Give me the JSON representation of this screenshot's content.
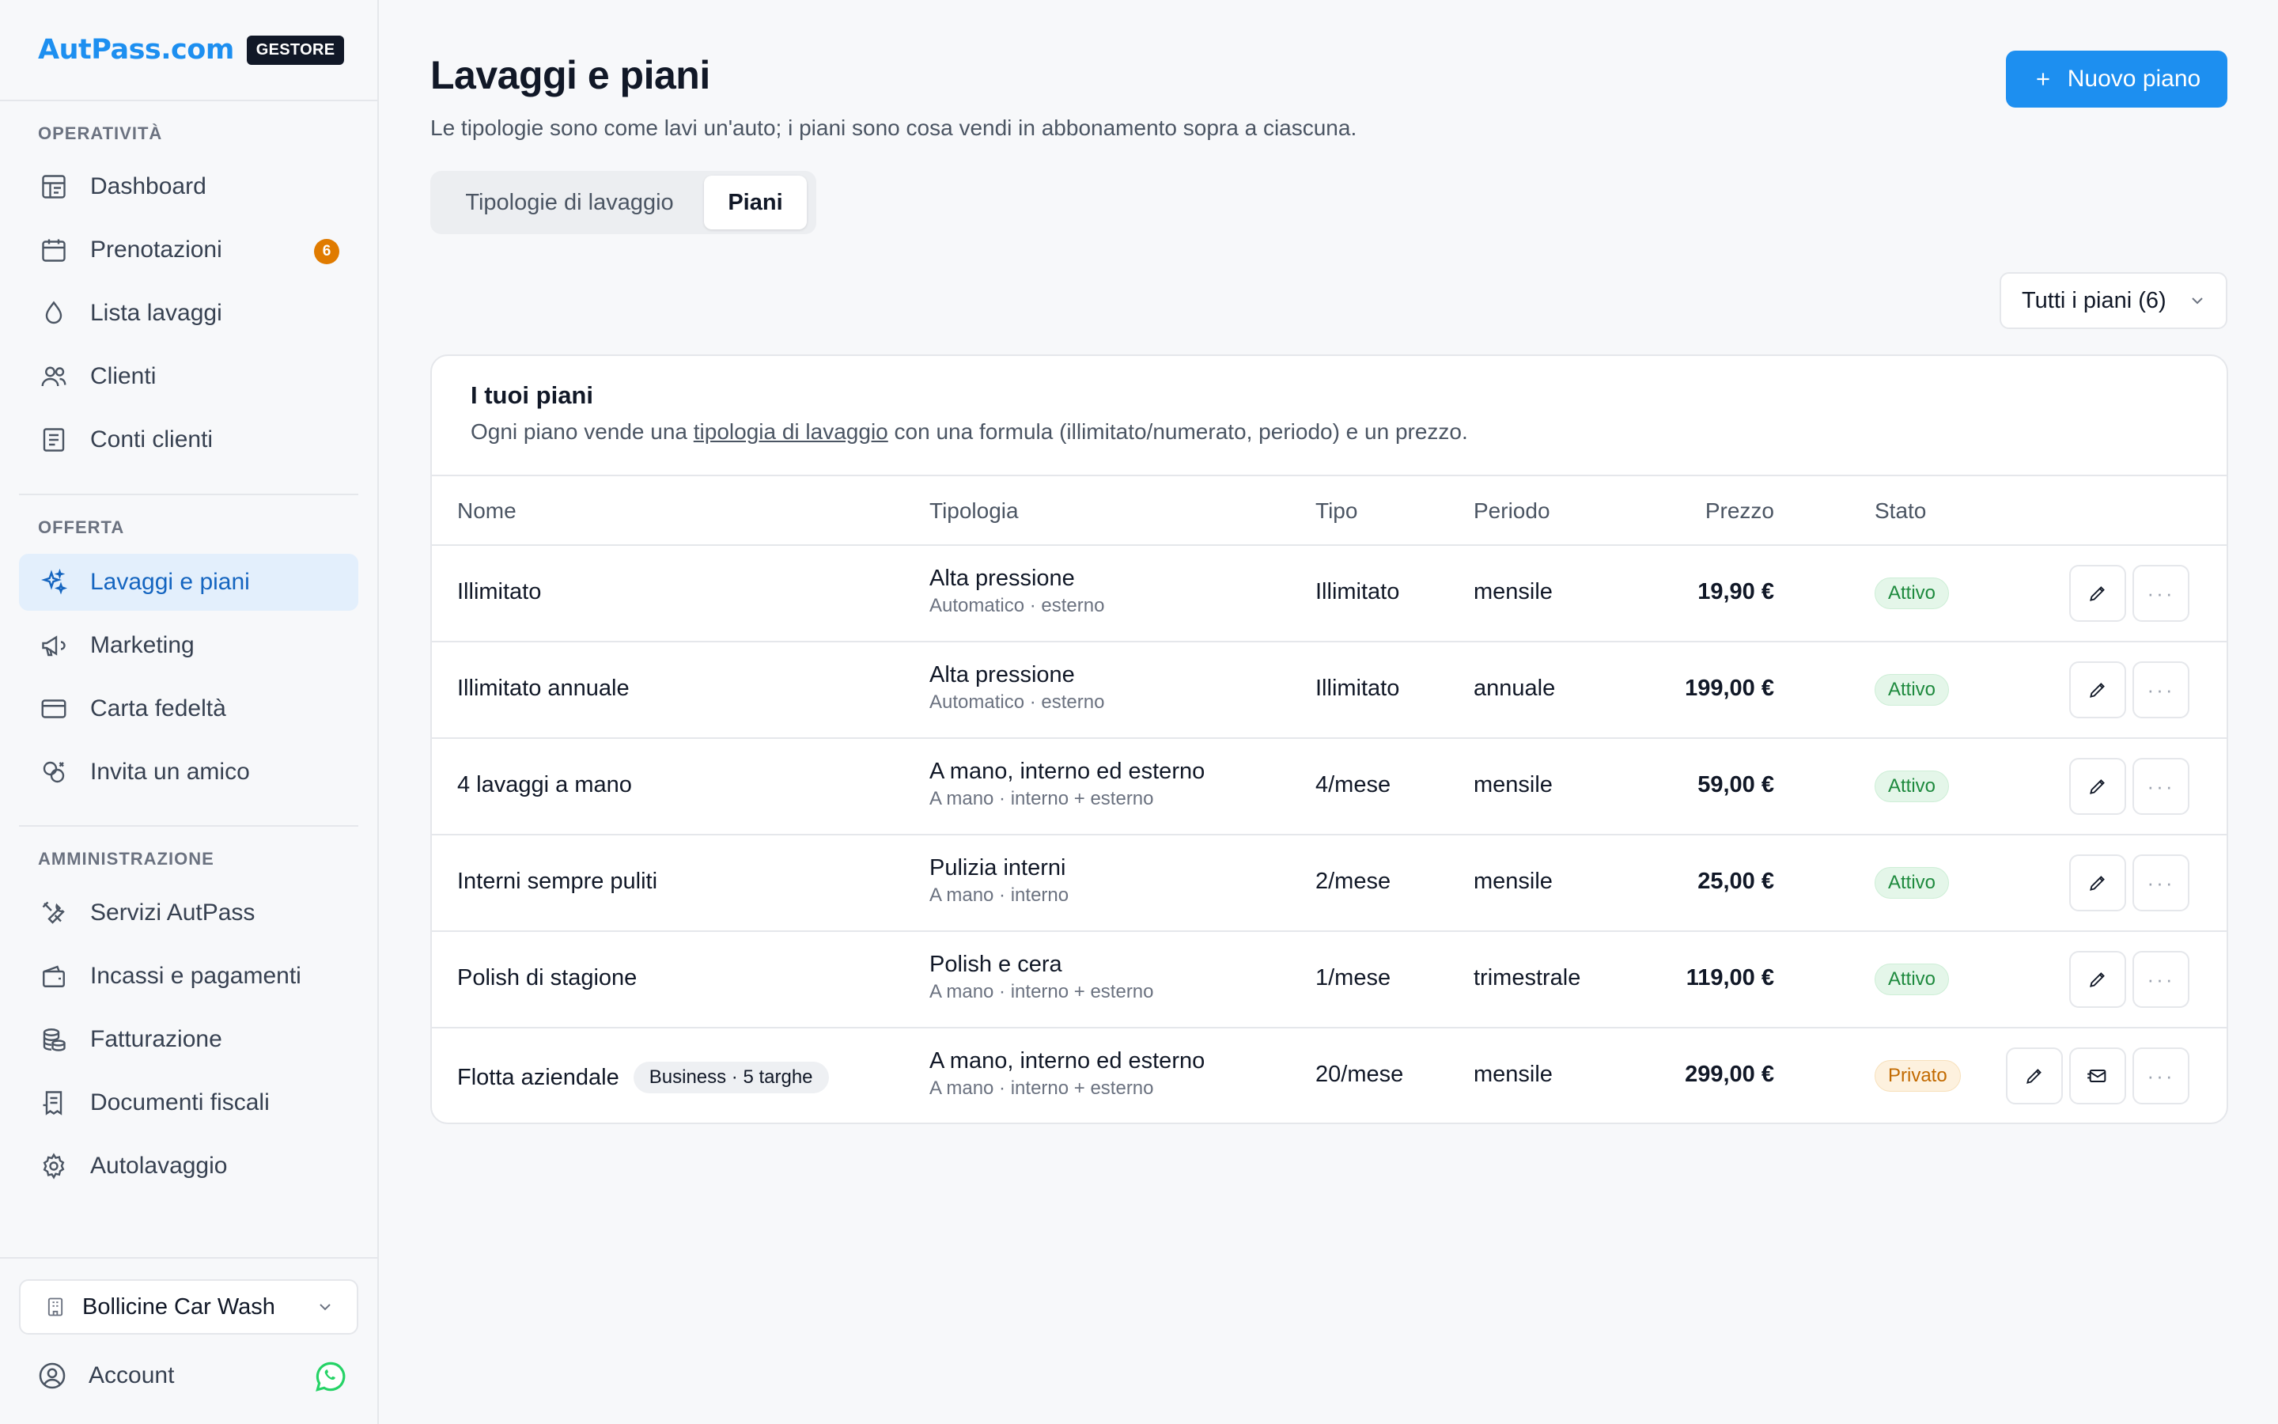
{
  "brand": {
    "logo": "AutPass.com",
    "badge": "GESTORE"
  },
  "sidebar": {
    "sections": [
      {
        "title": "OPERATIVITÀ"
      },
      {
        "title": "OFFERTA"
      },
      {
        "title": "AMMINISTRAZIONE"
      }
    ],
    "items": [
      {
        "label": "Dashboard",
        "icon": "dashboard-icon"
      },
      {
        "label": "Prenotazioni",
        "icon": "calendar-icon",
        "badge": "6"
      },
      {
        "label": "Lista lavaggi",
        "icon": "drop-icon"
      },
      {
        "label": "Clienti",
        "icon": "users-icon"
      },
      {
        "label": "Conti clienti",
        "icon": "ledger-icon"
      },
      {
        "label": "Lavaggi e piani",
        "icon": "sparkle-icon",
        "active": true
      },
      {
        "label": "Marketing",
        "icon": "megaphone-icon"
      },
      {
        "label": "Carta fedeltà",
        "icon": "card-icon"
      },
      {
        "label": "Invita un amico",
        "icon": "invite-icon"
      },
      {
        "label": "Servizi AutPass",
        "icon": "tools-icon"
      },
      {
        "label": "Incassi e pagamenti",
        "icon": "wallet-icon"
      },
      {
        "label": "Fatturazione",
        "icon": "coins-icon"
      },
      {
        "label": "Documenti fiscali",
        "icon": "receipt-icon"
      },
      {
        "label": "Autolavaggio",
        "icon": "gear-icon"
      }
    ],
    "store": {
      "name": "Bollicine Car Wash"
    },
    "account": {
      "label": "Account"
    }
  },
  "header": {
    "title": "Lavaggi e piani",
    "subtitle": "Le tipologie sono come lavi un'auto; i piani sono cosa vendi in abbonamento sopra a ciascuna.",
    "new_button": "Nuovo piano"
  },
  "tabs": [
    {
      "label": "Tipologie di lavaggio",
      "active": false
    },
    {
      "label": "Piani",
      "active": true
    }
  ],
  "filter": {
    "selected": "Tutti i piani (6)"
  },
  "card": {
    "title": "I tuoi piani",
    "subtitle_before": "Ogni piano vende una ",
    "subtitle_link": "tipologia di lavaggio",
    "subtitle_after": " con una formula (illimitato/numerato, periodo) e un prezzo."
  },
  "table": {
    "columns": [
      "Nome",
      "Tipologia",
      "Tipo",
      "Periodo",
      "Prezzo",
      "Stato"
    ],
    "rows": [
      {
        "name": "Illimitato",
        "badge": "",
        "tip_main": "Alta pressione",
        "tip_sub": "Automatico · esterno",
        "tipo": "Illimitato",
        "periodo": "mensile",
        "prezzo": "19,90 €",
        "stato": "Attivo",
        "stato_kind": "ok",
        "extra_action": false
      },
      {
        "name": "Illimitato annuale",
        "badge": "",
        "tip_main": "Alta pressione",
        "tip_sub": "Automatico · esterno",
        "tipo": "Illimitato",
        "periodo": "annuale",
        "prezzo": "199,00 €",
        "stato": "Attivo",
        "stato_kind": "ok",
        "extra_action": false
      },
      {
        "name": "4 lavaggi a mano",
        "badge": "",
        "tip_main": "A mano, interno ed esterno",
        "tip_sub": "A mano · interno + esterno",
        "tipo": "4/mese",
        "periodo": "mensile",
        "prezzo": "59,00 €",
        "stato": "Attivo",
        "stato_kind": "ok",
        "extra_action": false
      },
      {
        "name": "Interni sempre puliti",
        "badge": "",
        "tip_main": "Pulizia interni",
        "tip_sub": "A mano · interno",
        "tipo": "2/mese",
        "periodo": "mensile",
        "prezzo": "25,00 €",
        "stato": "Attivo",
        "stato_kind": "ok",
        "extra_action": false
      },
      {
        "name": "Polish di stagione",
        "badge": "",
        "tip_main": "Polish e cera",
        "tip_sub": "A mano · interno + esterno",
        "tipo": "1/mese",
        "periodo": "trimestrale",
        "prezzo": "119,00 €",
        "stato": "Attivo",
        "stato_kind": "ok",
        "extra_action": false
      },
      {
        "name": "Flotta aziendale",
        "badge": "Business · 5 targhe",
        "tip_main": "A mano, interno ed esterno",
        "tip_sub": "A mano · interno + esterno",
        "tipo": "20/mese",
        "periodo": "mensile",
        "prezzo": "299,00 €",
        "stato": "Privato",
        "stato_kind": "priv",
        "extra_action": true
      }
    ]
  },
  "colors": {
    "accent": "#1d8ff0",
    "active_bg": "#e3effc",
    "active_text": "#1565c0",
    "badge_orange": "#e07b00",
    "whatsapp": "#25d366"
  }
}
